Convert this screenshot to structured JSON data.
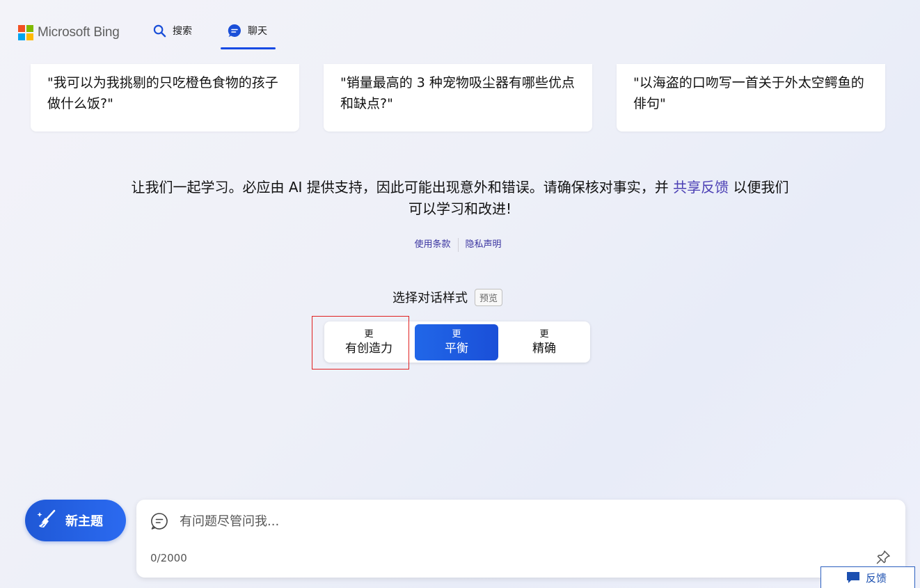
{
  "header": {
    "logo_text": "Microsoft Bing",
    "logo_colors": [
      "#f25022",
      "#7fba00",
      "#00a4ef",
      "#ffb900"
    ],
    "tabs": [
      {
        "label": "搜索",
        "icon": "search-icon"
      },
      {
        "label": "聊天",
        "icon": "chat-bubble-icon",
        "active": true
      }
    ],
    "accent_color": "#174ae4"
  },
  "suggestions": [
    "\"我可以为我挑剔的只吃橙色食物的孩子做什么饭?\"",
    "\"销量最高的 3 种宠物吸尘器有哪些优点和缺点?\"",
    "\"以海盗的口吻写一首关于外太空鳄鱼的俳句\""
  ],
  "disclaimer": {
    "text_before": "让我们一起学习。必应由 AI 提供支持，因此可能出现意外和错误。请确保核对事实，并 ",
    "link": "共享反馈",
    "text_after": " 以便我们可以学习和改进!"
  },
  "legal": {
    "terms": "使用条款",
    "privacy": "隐私声明"
  },
  "tone": {
    "title": "选择对话样式",
    "badge": "预览",
    "options": [
      {
        "small": "更",
        "big": "有创造力"
      },
      {
        "small": "更",
        "big": "平衡",
        "selected": true
      },
      {
        "small": "更",
        "big": "精确"
      }
    ]
  },
  "bottom": {
    "new_topic": "新主题",
    "input_placeholder": "有问题尽管问我...",
    "counter": "0/2000",
    "feedback": "反馈"
  }
}
